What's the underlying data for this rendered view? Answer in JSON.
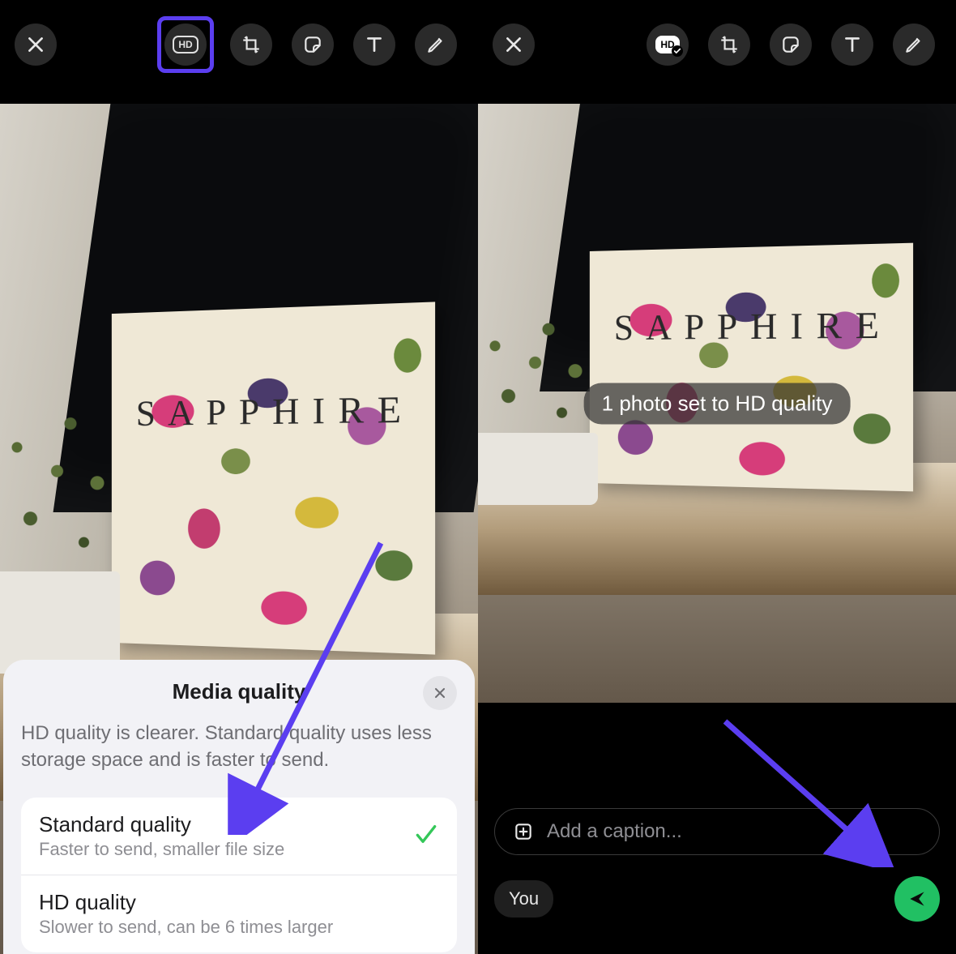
{
  "left": {
    "toolbar": {
      "close": "close",
      "hd": "HD",
      "crop": "crop-rotate",
      "sticker": "sticker",
      "text": "T",
      "draw": "draw"
    },
    "photo_subject_text": "SAPPHIRE",
    "sheet": {
      "title": "Media quality",
      "description": "HD quality is clearer. Standard quality uses less storage space and is faster to send.",
      "options": [
        {
          "title": "Standard quality",
          "subtitle": "Faster to send, smaller file size",
          "selected": true
        },
        {
          "title": "HD quality",
          "subtitle": "Slower to send, can be 6 times larger",
          "selected": false
        }
      ]
    }
  },
  "right": {
    "toolbar": {
      "close": "close",
      "hd": "HD",
      "crop": "crop-rotate",
      "sticker": "sticker",
      "text": "T",
      "draw": "draw"
    },
    "photo_subject_text": "SAPPHIRE",
    "toast": "1 photo set to HD quality",
    "caption_placeholder": "Add a caption...",
    "recipient": "You"
  },
  "annotation_color": "#5b3ef0"
}
